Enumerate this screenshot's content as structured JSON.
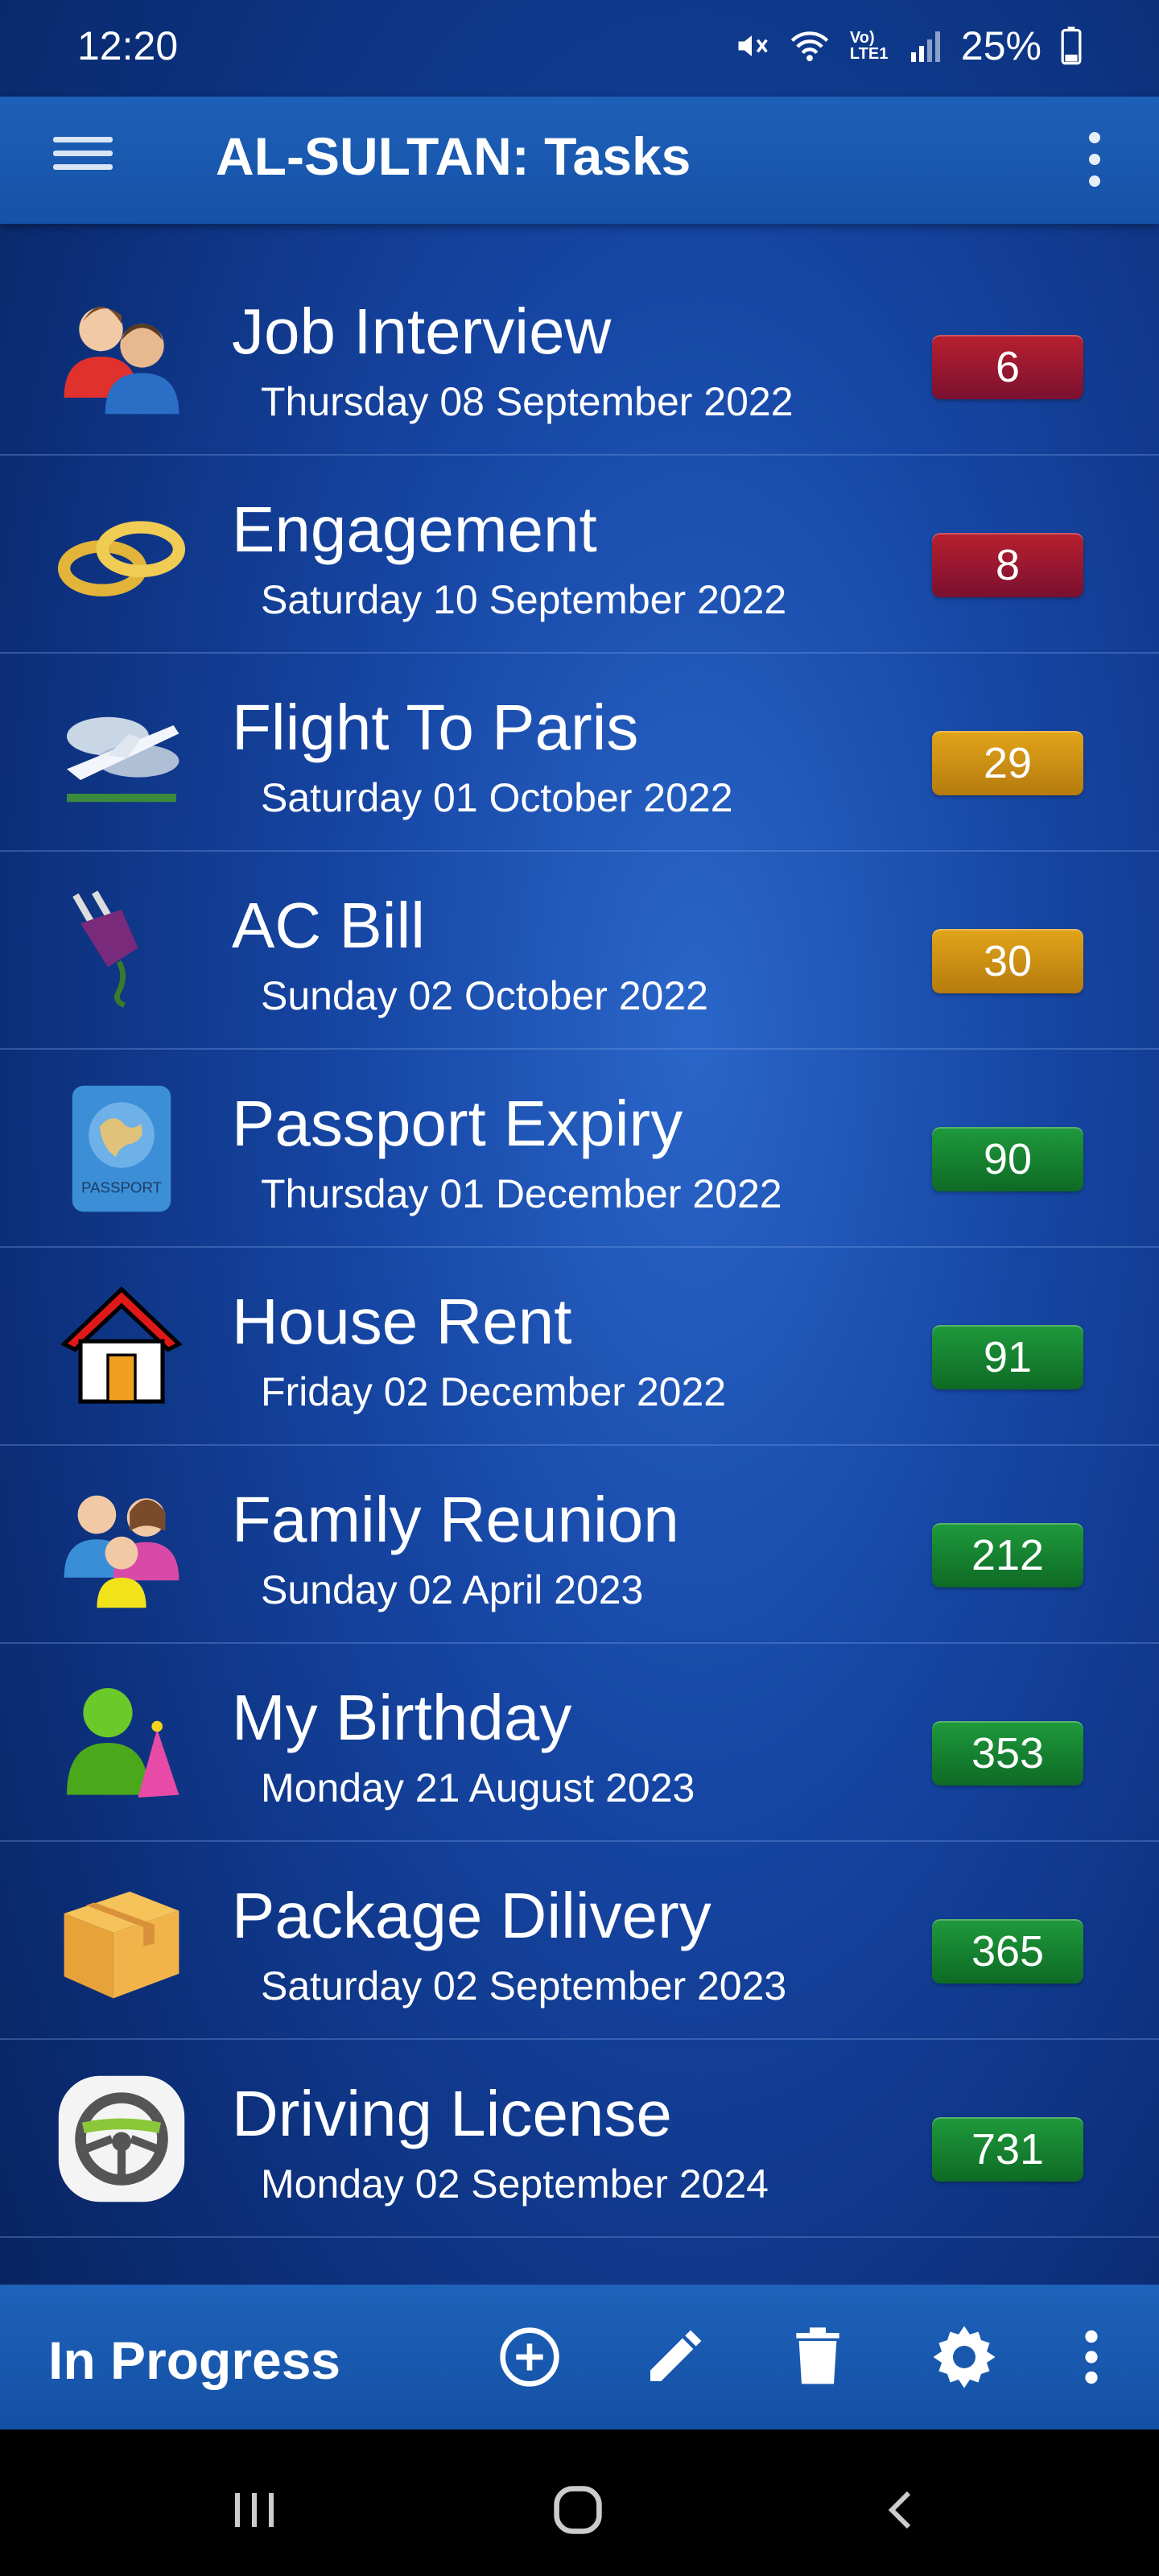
{
  "status_bar": {
    "time": "12:20",
    "network_label": "Vo) LTE1",
    "battery": "25%"
  },
  "app_bar": {
    "title": "AL-SULTAN: Tasks",
    "menu_icon": "hamburger-menu-icon",
    "overflow_icon": "more-vert-icon"
  },
  "tasks": [
    {
      "title": "Job Interview",
      "date": "Thursday 08 September 2022",
      "days": "6",
      "color": "#a0182f",
      "icon": "people-icon"
    },
    {
      "title": "Engagement",
      "date": "Saturday 10 September 2022",
      "days": "8",
      "color": "#a0182f",
      "icon": "rings-icon"
    },
    {
      "title": "Flight To Paris",
      "date": "Saturday 01 October 2022",
      "days": "29",
      "color": "#d3971a",
      "icon": "airplane-icon"
    },
    {
      "title": "AC Bill",
      "date": "Sunday 02 October 2022",
      "days": "30",
      "color": "#d3971a",
      "icon": "plug-icon"
    },
    {
      "title": "Passport Expiry",
      "date": "Thursday 01 December 2022",
      "days": "90",
      "color": "#16852f",
      "icon": "passport-icon",
      "icon_text": "PASSPORT"
    },
    {
      "title": "House Rent",
      "date": "Friday 02 December 2022",
      "days": "91",
      "color": "#16852f",
      "icon": "house-icon"
    },
    {
      "title": "Family Reunion",
      "date": "Sunday 02 April 2023",
      "days": "212",
      "color": "#16852f",
      "icon": "family-icon"
    },
    {
      "title": "My Birthday",
      "date": "Monday 21 August 2023",
      "days": "353",
      "color": "#16852f",
      "icon": "birthday-person-icon"
    },
    {
      "title": "Package Dilivery",
      "date": "Saturday 02 September 2023",
      "days": "365",
      "color": "#16852f",
      "icon": "package-box-icon"
    },
    {
      "title": "Driving License",
      "date": "Monday 02 September 2024",
      "days": "731",
      "color": "#16852f",
      "icon": "steering-wheel-icon"
    }
  ],
  "bottom_bar": {
    "filter_label": "In Progress",
    "actions": [
      "add-circle-icon",
      "edit-pencil-icon",
      "delete-trash-icon",
      "settings-gear-icon",
      "more-vert-icon"
    ]
  },
  "system_nav": [
    "recent-apps-icon",
    "home-icon",
    "back-icon"
  ]
}
